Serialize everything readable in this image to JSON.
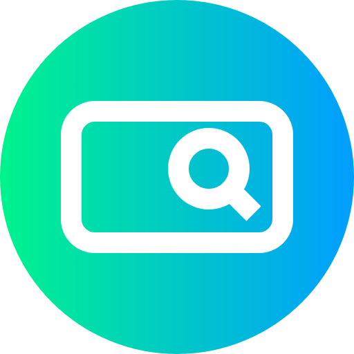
{
  "icon": {
    "name": "search-bar-icon",
    "parts": [
      "circle-background",
      "search-box-frame",
      "magnifier-icon"
    ],
    "colors": {
      "gradient_start": "#00f38d",
      "gradient_end": "#009eff",
      "stroke": "#ffffff"
    }
  }
}
